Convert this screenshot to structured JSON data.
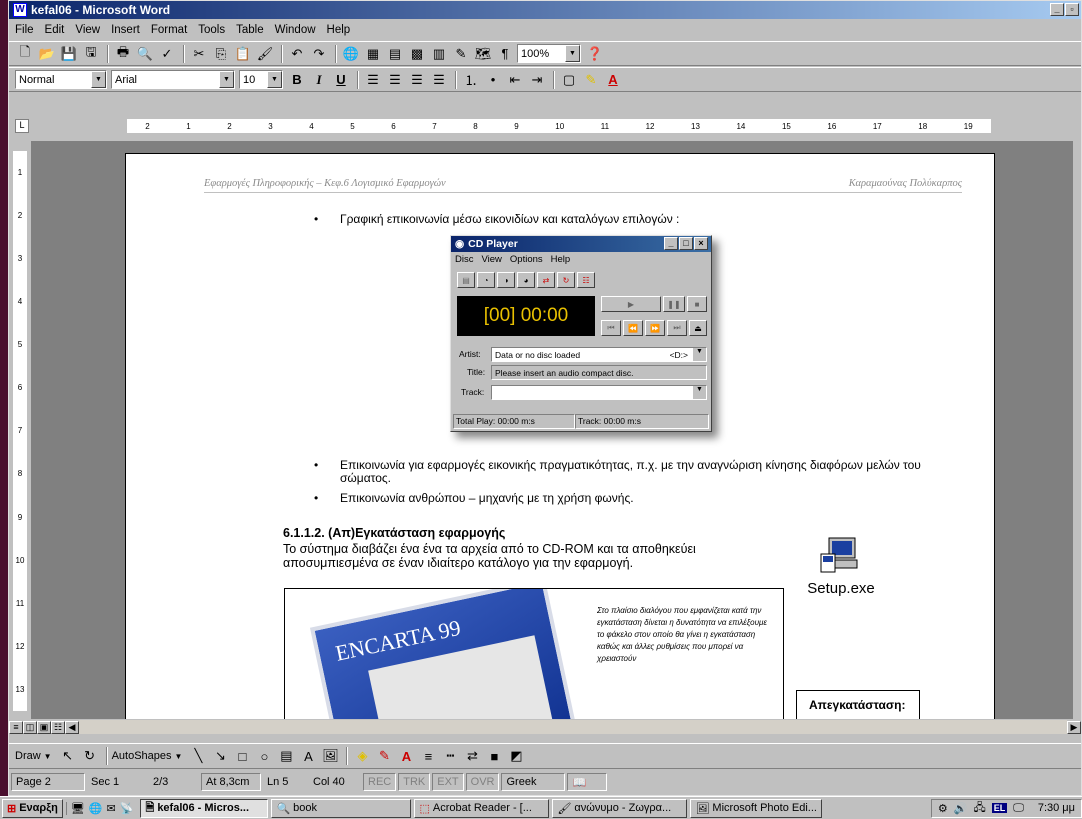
{
  "window": {
    "title": "kefal06 - Microsoft Word"
  },
  "menu": [
    "File",
    "Edit",
    "View",
    "Insert",
    "Format",
    "Tools",
    "Table",
    "Window",
    "Help"
  ],
  "toolbar": {
    "zoom": "100%"
  },
  "format": {
    "style": "Normal",
    "font": "Arial",
    "size": "10"
  },
  "ruler": {
    "left": "2",
    "ticks": [
      "1",
      "2",
      "3",
      "4",
      "5",
      "6",
      "7",
      "8",
      "9",
      "10",
      "11",
      "12",
      "13",
      "14",
      "15",
      "16",
      "17",
      "18",
      "19"
    ]
  },
  "vruler": [
    "1",
    "2",
    "3",
    "4",
    "5",
    "6",
    "7",
    "8",
    "9",
    "10",
    "11",
    "12",
    "13"
  ],
  "doc": {
    "header_left": "Εφαρμογές Πληροφορικής – Κεφ.6 Λογισμικό Εφαρμογών",
    "header_right": "Καραμαούνας Πολύκαρπος",
    "bullet1": "Γραφική επικοινωνία μέσω εικονιδίων και καταλόγων επιλογών :",
    "bullet2": "Επικοινωνία για εφαρμογές εικονικής πραγματικότητας, π.χ. με την αναγνώριση κίνησης διαφόρων μελών του σώματος.",
    "bullet3": "Επικοινωνία ανθρώπου – μηχανής με τη χρήση φωνής.",
    "heading": "6.1.1.2. (Απ)Εγκατάσταση εφαρμογής",
    "para": "Το σύστημα διαβάζει ένα ένα τα αρχεία από το CD-ROM και τα αποθηκεύει αποσυμπιεσμένα σε έναν ιδιαίτερο κατάλογο για την εφαρμογή.",
    "setup_label": "Setup.exe",
    "enc_logo": "ENCARTA 99",
    "enc_caption": "Στο πλαίσιο διαλόγου που εμφανίζεται κατά την εγκατάσταση δίνεται η δυνατότητα να επιλέξουμε το φάκελο στον οποίο θα γίνει η εγκατάσταση καθώς και άλλες ρυθμίσεις που μπορεί να χρειαστούν",
    "uninstall": "Απεγκατάσταση:"
  },
  "cdplayer": {
    "title": "CD Player",
    "menu": [
      "Disc",
      "View",
      "Options",
      "Help"
    ],
    "display": "[00] 00:00",
    "artist_label": "Artist:",
    "artist_value": "Data or no disc loaded",
    "artist_drive": "<D:>",
    "title_label": "Title:",
    "title_value": "Please insert an audio compact disc.",
    "track_label": "Track:",
    "total_play": "Total Play: 00:00 m:s",
    "track_time": "Track: 00:00 m:s"
  },
  "drawbar": {
    "draw": "Draw",
    "autoshapes": "AutoShapes"
  },
  "status": {
    "page": "Page 2",
    "sec": "Sec 1",
    "pages": "2/3",
    "at": "At 8,3cm",
    "ln": "Ln 5",
    "col": "Col 40",
    "rec": "REC",
    "trk": "TRK",
    "ext": "EXT",
    "ovr": "OVR",
    "lang": "Greek"
  },
  "taskbar": {
    "start": "Εναρξη",
    "tasks": [
      "kefal06 - Micros...",
      "book",
      "Acrobat Reader - [...",
      "ανώνυμο - Ζωγρα...",
      "Microsoft Photo Edi..."
    ],
    "lang": "EL",
    "clock": "7:30 μμ"
  }
}
